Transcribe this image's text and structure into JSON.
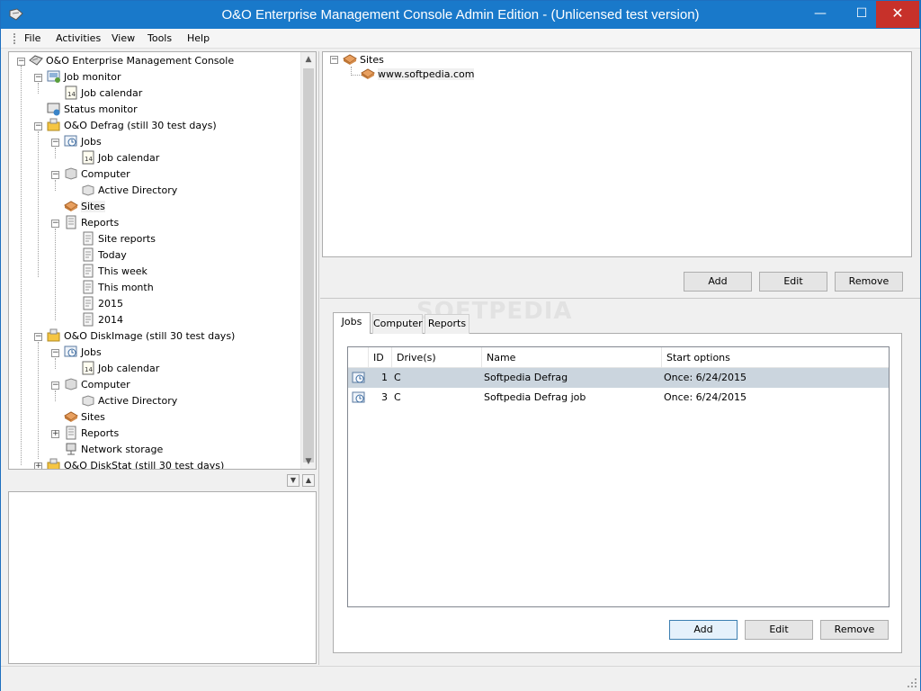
{
  "window": {
    "title": "O&O Enterprise Management Console Admin Edition -  (Unlicensed test version)",
    "min_glyph": "—",
    "max_glyph": "☐",
    "close_glyph": "✕"
  },
  "menu": [
    "File",
    "Activities",
    "View",
    "Tools",
    "Help"
  ],
  "tree": [
    {
      "label": "O&O Enterprise Management Console",
      "icon": "console-icon"
    },
    {
      "label": "Job monitor",
      "icon": "job-monitor-icon"
    },
    {
      "label": "Job calendar",
      "icon": "calendar-icon"
    },
    {
      "label": "Status monitor",
      "icon": "status-monitor-icon"
    },
    {
      "label": "O&O Defrag (still 30 test days)",
      "icon": "product-folder-icon"
    },
    {
      "label": "Jobs",
      "icon": "jobs-icon"
    },
    {
      "label": "Job calendar",
      "icon": "calendar-icon"
    },
    {
      "label": "Computer",
      "icon": "computer-icon"
    },
    {
      "label": "Active Directory",
      "icon": "active-directory-icon"
    },
    {
      "label": "Sites",
      "icon": "sites-icon"
    },
    {
      "label": "Reports",
      "icon": "reports-icon"
    },
    {
      "label": "Site reports",
      "icon": "report-page-icon"
    },
    {
      "label": "Today",
      "icon": "report-page-icon"
    },
    {
      "label": "This week",
      "icon": "report-page-icon"
    },
    {
      "label": "This month",
      "icon": "report-page-icon"
    },
    {
      "label": "2015",
      "icon": "report-page-icon"
    },
    {
      "label": "2014",
      "icon": "report-page-icon"
    },
    {
      "label": "O&O DiskImage (still 30 test days)",
      "icon": "product-folder-icon"
    },
    {
      "label": "Jobs",
      "icon": "jobs-icon"
    },
    {
      "label": "Job calendar",
      "icon": "calendar-icon"
    },
    {
      "label": "Computer",
      "icon": "computer-icon"
    },
    {
      "label": "Active Directory",
      "icon": "active-directory-icon"
    },
    {
      "label": "Sites",
      "icon": "sites-icon"
    },
    {
      "label": "Reports",
      "icon": "reports-icon"
    },
    {
      "label": "Network storage",
      "icon": "network-storage-icon"
    },
    {
      "label": "O&O DiskStat (still 30 test days)",
      "icon": "product-folder-icon"
    }
  ],
  "tree_calendar_glyph": "14",
  "sites": {
    "root": "Sites",
    "child": "www.softpedia.com"
  },
  "sites_buttons": {
    "add": "Add",
    "edit": "Edit",
    "remove": "Remove"
  },
  "tabs": [
    "Jobs",
    "Computer",
    "Reports"
  ],
  "grid": {
    "columns": [
      "ID",
      "Drive(s)",
      "Name",
      "Start options"
    ],
    "rows": [
      {
        "id": "1",
        "drive": "C",
        "name": "Softpedia Defrag",
        "start": "Once: 6/24/2015"
      },
      {
        "id": "3",
        "drive": "C",
        "name": "Softpedia Defrag job",
        "start": "Once: 6/24/2015"
      }
    ]
  },
  "jobs_buttons": {
    "add": "Add",
    "edit": "Edit",
    "remove": "Remove"
  },
  "watermark": "SOFTPEDIA",
  "colors": {
    "titlebar": "#1979ca",
    "close": "#c7312a",
    "selection": "#cbd5de"
  }
}
